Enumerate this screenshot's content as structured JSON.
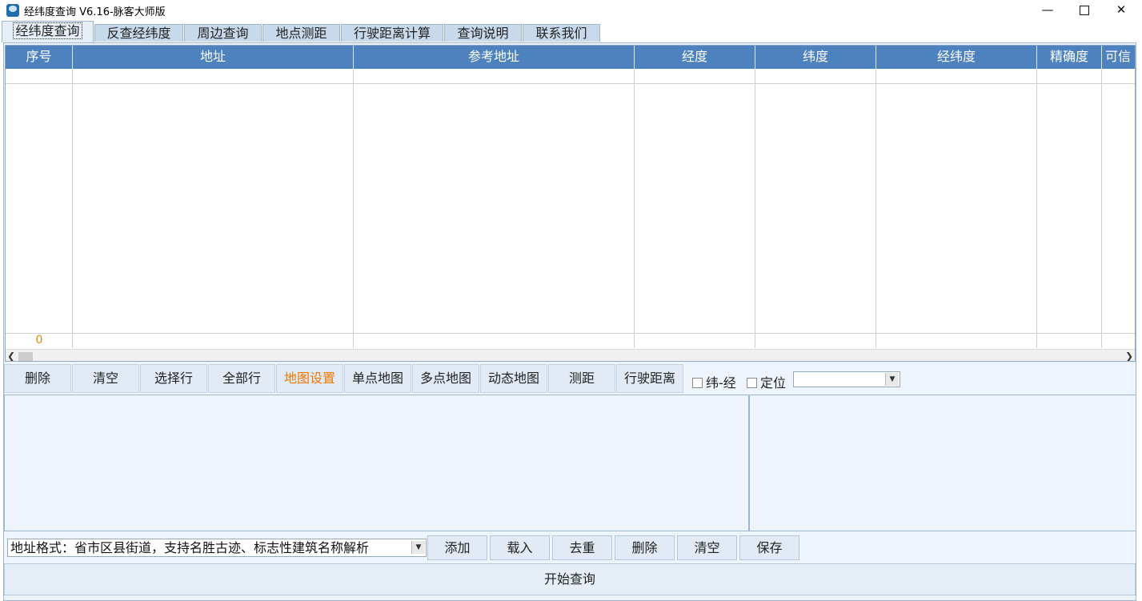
{
  "window": {
    "title": "经纬度查询 V6.16-脉客大师版",
    "minimize": "—",
    "close": "✕"
  },
  "tabs": [
    {
      "label": "经纬度查询",
      "active": true
    },
    {
      "label": "反查经纬度"
    },
    {
      "label": "周边查询"
    },
    {
      "label": "地点测距"
    },
    {
      "label": "行驶距离计算"
    },
    {
      "label": "查询说明"
    },
    {
      "label": "联系我们"
    }
  ],
  "grid": {
    "columns": [
      "序号",
      "地址",
      "参考地址",
      "经度",
      "纬度",
      "经纬度",
      "精确度",
      "可信"
    ],
    "row_count": "0"
  },
  "toolbar": {
    "delete": "删除",
    "clear": "清空",
    "select_rows": "选择行",
    "all_rows": "全部行",
    "map_settings": "地图设置",
    "single_map": "单点地图",
    "multi_map": "多点地图",
    "dynamic_map": "动态地图",
    "measure": "测距",
    "drive_distance": "行驶距离",
    "lat_lng_label": "纬-经",
    "locate_label": "定位"
  },
  "address": {
    "format_hint": "地址格式：省市区县街道，支持名胜古迹、标志性建筑名称解析",
    "add": "添加",
    "load": "载入",
    "dedupe": "去重",
    "delete": "删除",
    "clear": "清空",
    "save": "保存"
  },
  "start_query": "开始查询",
  "colors": {
    "header_blue": "#4e82bf",
    "accent_orange": "#f07800",
    "panel_bg": "#eef4fc"
  }
}
